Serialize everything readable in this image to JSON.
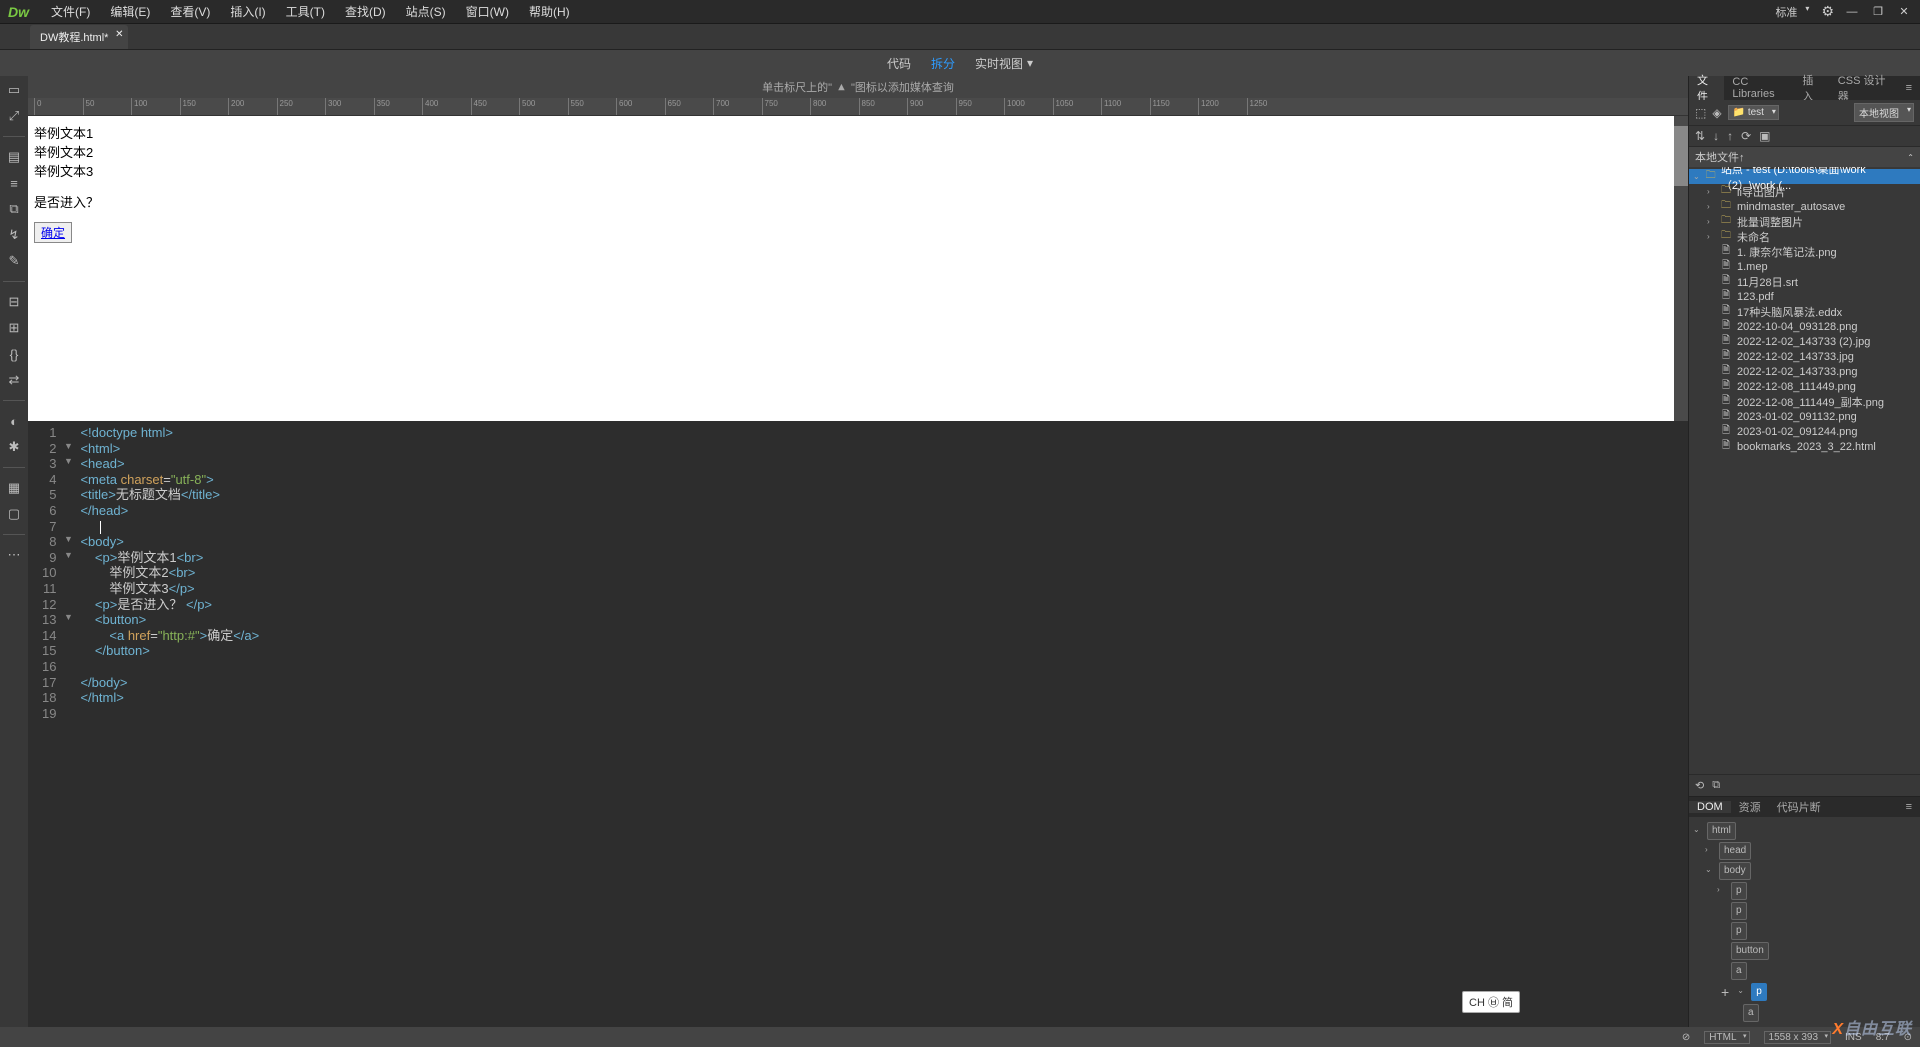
{
  "menu": {
    "file": "文件(F)",
    "edit": "编辑(E)",
    "view": "查看(V)",
    "insert": "插入(I)",
    "tools": "工具(T)",
    "find": "查找(D)",
    "site": "站点(S)",
    "window": "窗口(W)",
    "help": "帮助(H)",
    "layout": "标准"
  },
  "doc_tab": {
    "name": "DW教程.html*"
  },
  "view_modes": {
    "code": "代码",
    "split": "拆分",
    "live": "实时视图"
  },
  "media_hint": {
    "before": "单击标尺上的\"",
    "after": "\"图标以添加媒体查询"
  },
  "ruler_marks": [
    0,
    50,
    100,
    150,
    200,
    250,
    300,
    350,
    400,
    450,
    500,
    550,
    600,
    650,
    700,
    750,
    800,
    850,
    900,
    950,
    1000,
    1050,
    1100,
    1150,
    1200,
    1250
  ],
  "preview": {
    "p1": "举例文本1",
    "p2": "举例文本2",
    "p3": "举例文本3",
    "question": "是否进入？",
    "btn": "确定"
  },
  "code_lines": [
    {
      "n": 1,
      "f": "",
      "html": "<span class='t-tag'>&lt;!doctype html&gt;</span>"
    },
    {
      "n": 2,
      "f": "▼",
      "html": "<span class='t-tag'>&lt;html&gt;</span>"
    },
    {
      "n": 3,
      "f": "▼",
      "html": "<span class='t-tag'>&lt;head&gt;</span>"
    },
    {
      "n": 4,
      "f": "",
      "html": "<span class='t-tag'>&lt;meta</span> <span class='t-attr'>charset</span>=<span class='t-str'>\"utf-8\"</span><span class='t-tag'>&gt;</span>"
    },
    {
      "n": 5,
      "f": "",
      "html": "<span class='t-tag'>&lt;title&gt;</span><span class='t-text'>无标题文档</span><span class='t-tag'>&lt;/title&gt;</span>"
    },
    {
      "n": 6,
      "f": "",
      "html": "<span class='t-tag'>&lt;/head&gt;</span>"
    },
    {
      "n": 7,
      "f": "",
      "html": ""
    },
    {
      "n": 8,
      "f": "▼",
      "html": "<span class='t-tag'>&lt;body&gt;</span>"
    },
    {
      "n": 9,
      "f": "▼",
      "html": "    <span class='t-tag'>&lt;p&gt;</span><span class='t-text'>举例文本1</span><span class='t-tag'>&lt;br&gt;</span>"
    },
    {
      "n": 10,
      "f": "",
      "html": "        <span class='t-text'>举例文本2</span><span class='t-tag'>&lt;br&gt;</span>"
    },
    {
      "n": 11,
      "f": "",
      "html": "        <span class='t-text'>举例文本3</span><span class='t-tag'>&lt;/p&gt;</span>"
    },
    {
      "n": 12,
      "f": "",
      "html": "    <span class='t-tag'>&lt;p&gt;</span><span class='t-text'>是否进入？</span> <span class='t-tag'>&lt;/p&gt;</span>"
    },
    {
      "n": 13,
      "f": "▼",
      "html": "    <span class='t-tag'>&lt;button&gt;</span>"
    },
    {
      "n": 14,
      "f": "",
      "html": "        <span class='t-tag'>&lt;a</span> <span class='t-attr'>href</span>=<span class='t-str'>\"http:#\"</span><span class='t-tag'>&gt;</span><span class='t-text'>确定</span><span class='t-tag'>&lt;/a&gt;</span>"
    },
    {
      "n": 15,
      "f": "",
      "html": "    <span class='t-tag'>&lt;/button&gt;</span>"
    },
    {
      "n": 16,
      "f": "",
      "html": ""
    },
    {
      "n": 17,
      "f": "",
      "html": "<span class='t-tag'>&lt;/body&gt;</span>"
    },
    {
      "n": 18,
      "f": "",
      "html": "<span class='t-tag'>&lt;/html&gt;</span>"
    },
    {
      "n": 19,
      "f": "",
      "html": ""
    }
  ],
  "right_panel": {
    "tabs": {
      "files": "文件",
      "cc": "CC Libraries",
      "insert": "插入",
      "css": "CSS 设计器"
    },
    "site_dropdown": "test",
    "view_dropdown": "本地视图",
    "local_files_label": "本地文件↑",
    "root": "站点 - test (D:\\tools\\桌面\\work（2）\\work (...",
    "folders": [
      "li导出图片",
      "mindmaster_autosave",
      "批量调整图片",
      "未命名"
    ],
    "files": [
      "1. 康奈尔笔记法.png",
      "1.mep",
      "11月28日.srt",
      "123.pdf",
      "17种头脑风暴法.eddx",
      "2022-10-04_093128.png",
      "2022-12-02_143733 (2).jpg",
      "2022-12-02_143733.jpg",
      "2022-12-02_143733.png",
      "2022-12-08_111449.png",
      "2022-12-08_111449_副本.png",
      "2023-01-02_091132.png",
      "2023-01-02_091244.png",
      "bookmarks_2023_3_22.html"
    ]
  },
  "dom_panel": {
    "tabs": {
      "dom": "DOM",
      "assets": "资源",
      "snippets": "代码片断"
    },
    "nodes": {
      "html": "html",
      "head": "head",
      "body": "body",
      "p": "p",
      "button": "button",
      "a": "a"
    }
  },
  "statusbar": {
    "doctype_label": "HTML",
    "size": "1558 x 393",
    "ins": "INS",
    "pos": "8:7",
    "encoding": "⊙"
  },
  "ime": "CH ㉥ 简",
  "watermark": "自由互联"
}
